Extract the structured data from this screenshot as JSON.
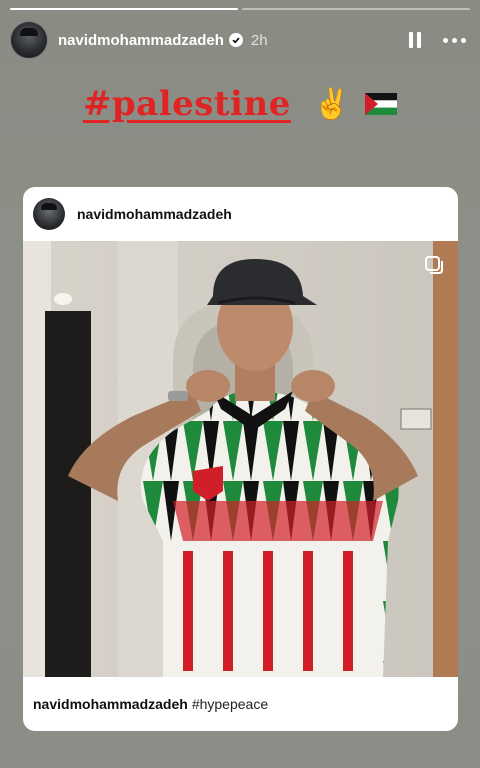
{
  "story": {
    "username": "navidmohammadzadeh",
    "time": "2h",
    "progress": [
      1,
      0,
      0
    ]
  },
  "sticker": {
    "hashtag": "#palestine",
    "emoji_peace": "✌️"
  },
  "post": {
    "username": "navidmohammadzadeh",
    "caption_user": "navidmohammadzadeh",
    "caption_text": "#hypepeace"
  },
  "colors": {
    "hashtag": "#e02424",
    "flag_red": "#d11f2a",
    "flag_green": "#1f8a3b"
  }
}
